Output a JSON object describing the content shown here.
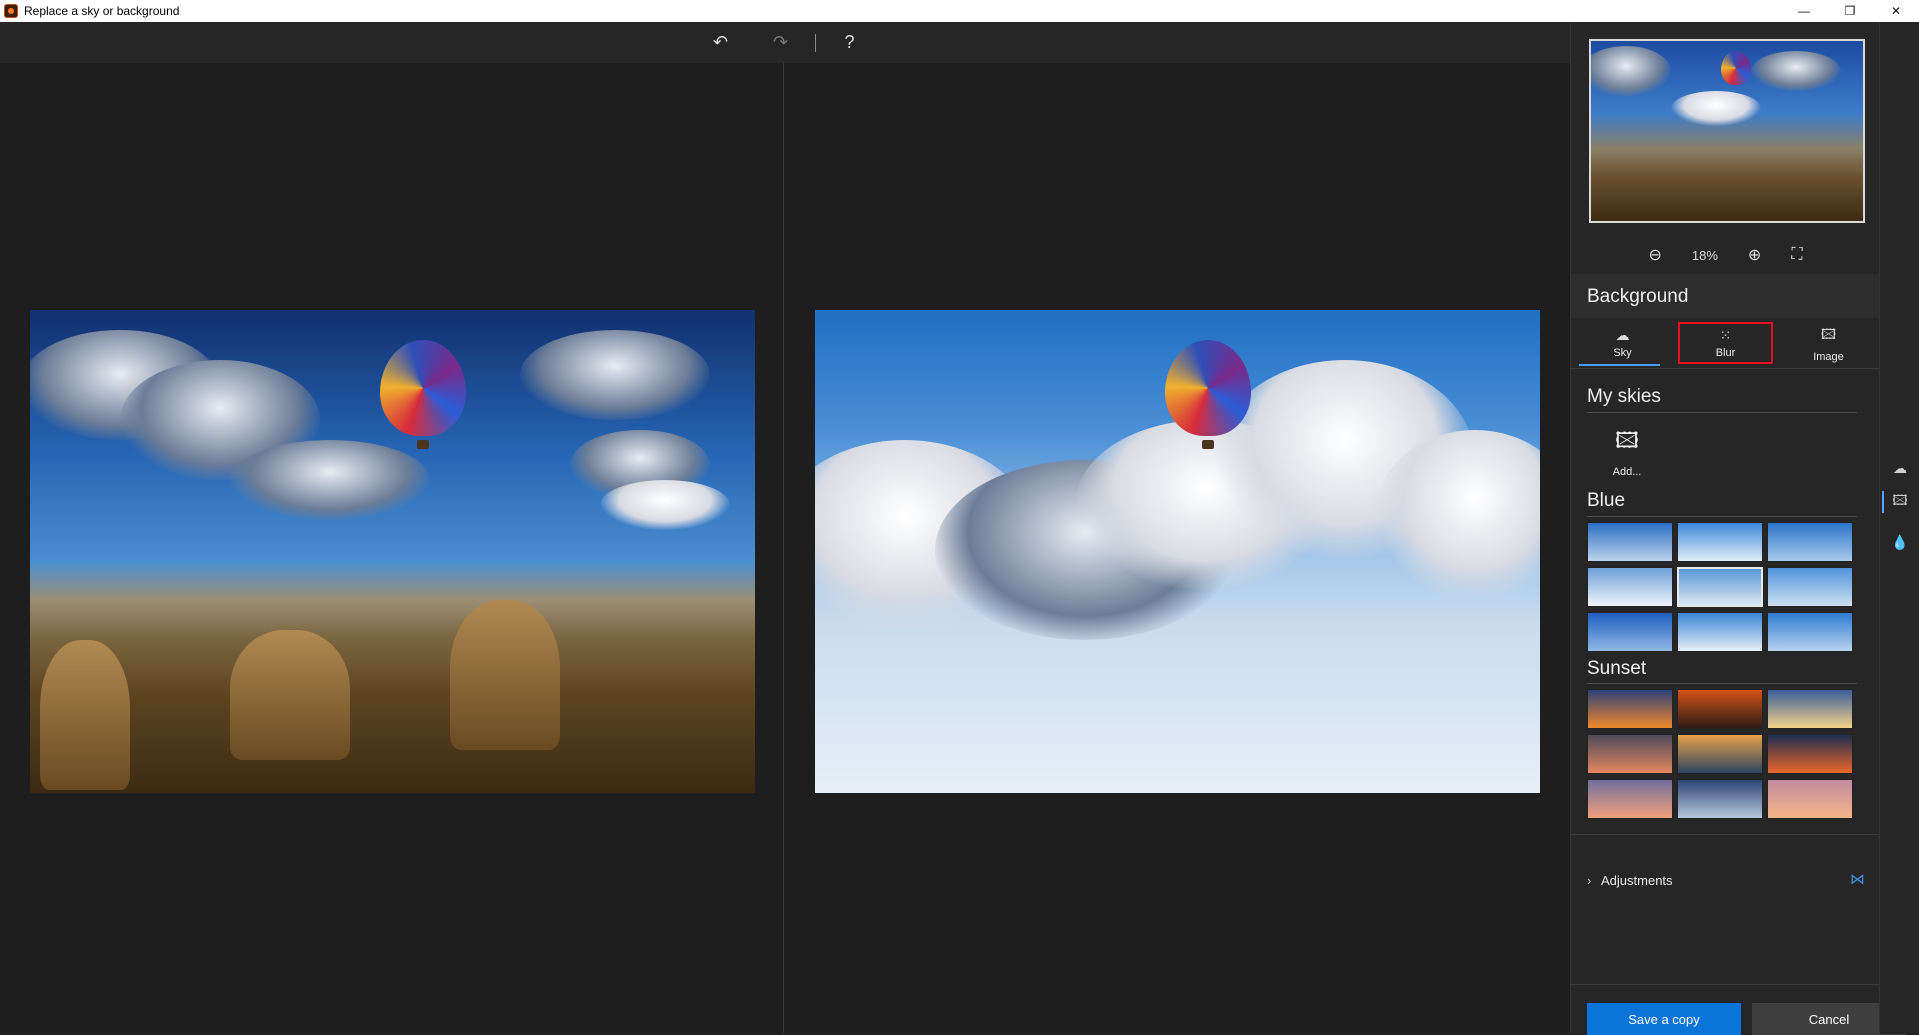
{
  "window": {
    "title": "Replace a sky or background",
    "minimize": "—",
    "restore": "❐",
    "close": "✕"
  },
  "toolbar": {
    "undo_icon": "↶",
    "redo_icon": "↷",
    "help_label": "?"
  },
  "panel": {
    "zoom_out_icon": "⊖",
    "zoom_level": "18%",
    "zoom_in_icon": "⊕",
    "fit_icon": "⛶",
    "background_title": "Background",
    "tabs": [
      {
        "label": "Sky",
        "icon": "☁",
        "active": true
      },
      {
        "label": "Blur",
        "icon": "⁙",
        "active": false,
        "highlighted": true
      },
      {
        "label": "Image",
        "icon": "🖾",
        "active": false
      }
    ],
    "my_skies_title": "My skies",
    "add_label": "Add...",
    "add_icon": "🖾",
    "blue_title": "Blue",
    "sunset_title": "Sunset",
    "blue_thumbs": [
      {
        "colors": [
          "#2a6fc4",
          "#bcd4ee"
        ]
      },
      {
        "colors": [
          "#3d8ad8",
          "#e1edf8"
        ]
      },
      {
        "colors": [
          "#2c74c8",
          "#a9cbec"
        ]
      },
      {
        "colors": [
          "#6aa0d8",
          "#f0f4f8"
        ]
      },
      {
        "colors": [
          "#5b98d6",
          "#d9e6f3"
        ],
        "selected": true
      },
      {
        "colors": [
          "#4f93dc",
          "#cfe0f1"
        ]
      },
      {
        "colors": [
          "#1f5fbf",
          "#8fb8e6"
        ]
      },
      {
        "colors": [
          "#3a86d8",
          "#e8f0f8"
        ]
      },
      {
        "colors": [
          "#2f7ad0",
          "#b8d3ee"
        ]
      }
    ],
    "sunset_thumbs": [
      {
        "colors": [
          "#2b3f78",
          "#f08a2a"
        ]
      },
      {
        "colors": [
          "#d4521a",
          "#2b1c14"
        ]
      },
      {
        "colors": [
          "#3b5d9a",
          "#f3d28b"
        ]
      },
      {
        "colors": [
          "#4d4a5a",
          "#e4875f"
        ]
      },
      {
        "colors": [
          "#e7a04a",
          "#2e4560"
        ]
      },
      {
        "colors": [
          "#1f2e4f",
          "#e9672b"
        ]
      },
      {
        "colors": [
          "#6f6f9e",
          "#f2a07a"
        ]
      },
      {
        "colors": [
          "#2b4474",
          "#b8c7dc"
        ]
      },
      {
        "colors": [
          "#c28aa0",
          "#f4b58a"
        ]
      }
    ],
    "adjustments_label": "Adjustments",
    "adjustments_chevron": "›",
    "compare_icon": "⋈",
    "save_label": "Save a copy",
    "cancel_label": "Cancel"
  },
  "rail": {
    "icons": [
      "☁",
      "🖾",
      "💧"
    ]
  }
}
